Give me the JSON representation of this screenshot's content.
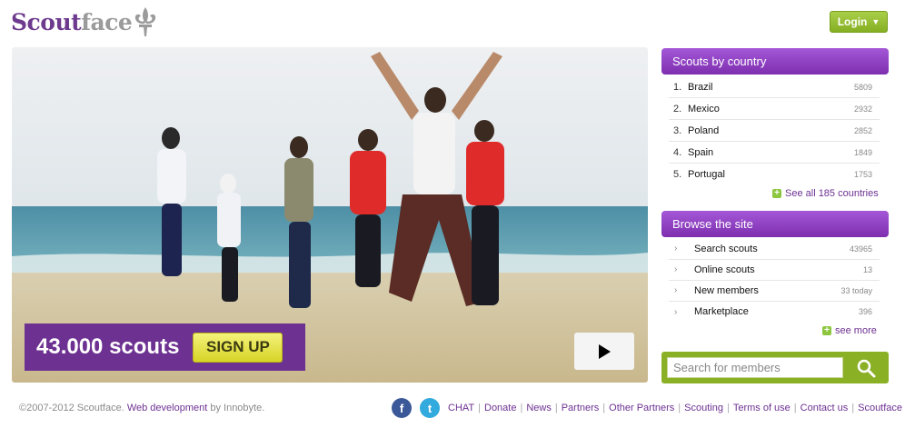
{
  "brand": {
    "part1": "Scout",
    "part2": "face"
  },
  "header": {
    "login_label": "Login"
  },
  "hero": {
    "count_text": "43.000 scouts",
    "signup_label": "SIGN UP"
  },
  "countries": {
    "title": "Scouts by country",
    "items": [
      {
        "rank": "1.",
        "name": "Brazil",
        "count": "5809"
      },
      {
        "rank": "2.",
        "name": "Mexico",
        "count": "2932"
      },
      {
        "rank": "3.",
        "name": "Poland",
        "count": "2852"
      },
      {
        "rank": "4.",
        "name": "Spain",
        "count": "1849"
      },
      {
        "rank": "5.",
        "name": "Portugal",
        "count": "1753"
      }
    ],
    "see_all": "See all 185 countries"
  },
  "browse": {
    "title": "Browse the site",
    "items": [
      {
        "name": "Search scouts",
        "count": "43965"
      },
      {
        "name": "Online scouts",
        "count": "13"
      },
      {
        "name": "New members",
        "count": "33 today"
      },
      {
        "name": "Marketplace",
        "count": "396"
      }
    ],
    "see_more": "see more"
  },
  "search": {
    "placeholder": "Search for members"
  },
  "footer": {
    "copyright": "©2007-2012 Scoutface.",
    "webdev": "Web development",
    "by": "by Innobyte.",
    "links": [
      "CHAT",
      "Donate",
      "News",
      "Partners",
      "Other Partners",
      "Scouting",
      "Terms of use",
      "Contact us",
      "Scoutface"
    ]
  },
  "colors": {
    "purple": "#6d3192",
    "green": "#8ab026",
    "yellow": "#e6e34a"
  }
}
